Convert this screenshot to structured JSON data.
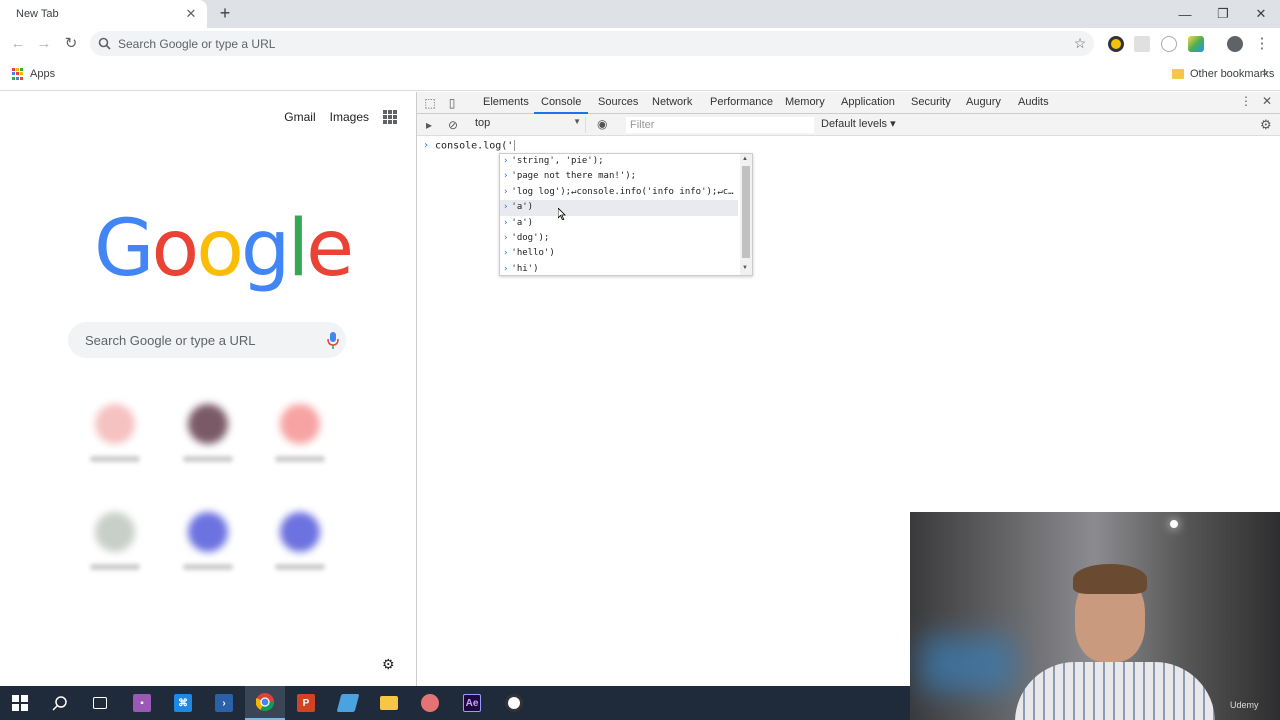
{
  "browser": {
    "tab_title": "New Tab",
    "omnibox_placeholder": "Search Google or type a URL",
    "bookmarks": {
      "apps_label": "Apps",
      "other_label": "Other bookmarks"
    }
  },
  "newtab": {
    "links": {
      "gmail": "Gmail",
      "images": "Images"
    },
    "logo": [
      "G",
      "o",
      "o",
      "g",
      "l",
      "e"
    ],
    "search_placeholder": "Search Google or type a URL"
  },
  "devtools": {
    "tabs": [
      "Elements",
      "Console",
      "Sources",
      "Network",
      "Performance",
      "Memory",
      "Application",
      "Security",
      "Augury",
      "Audits"
    ],
    "active_tab": "Console",
    "context": "top",
    "filter_placeholder": "Filter",
    "levels": "Default levels",
    "input": "console.log('",
    "suggestions": [
      "'string', 'pie');",
      "'page not there man!');",
      "'log log');↵console.info('info info');↵c...",
      "'a')",
      "'a')",
      "'dog');",
      "'hello')",
      "'hi')"
    ]
  },
  "webcam": {
    "watermark": "Udemy"
  },
  "colors": {
    "blue": "#4285f4",
    "red": "#ea4335",
    "yellow": "#fbbc05",
    "green": "#34a853"
  }
}
